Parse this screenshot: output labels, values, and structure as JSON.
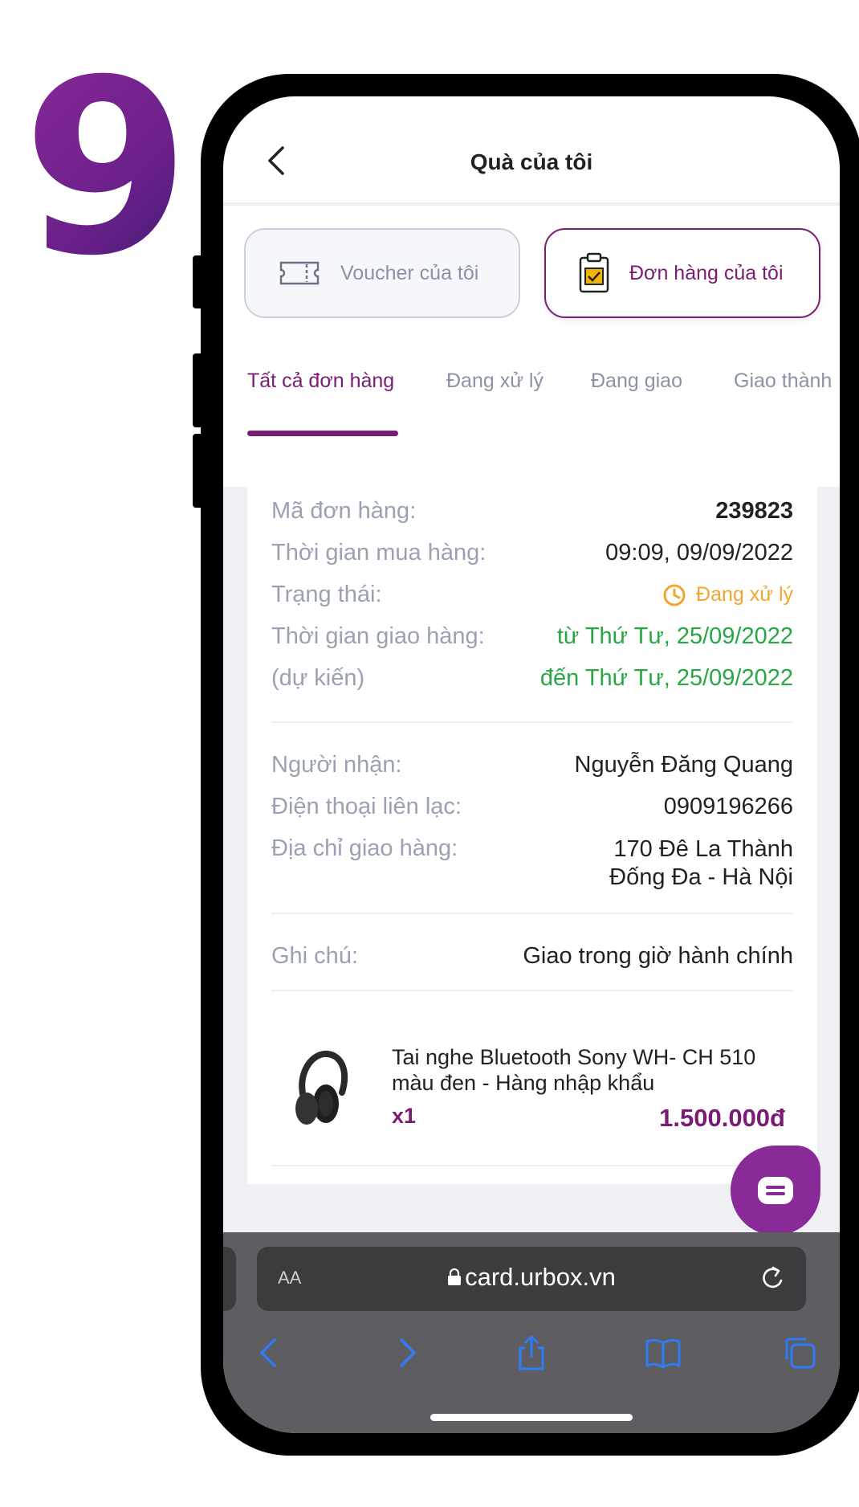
{
  "step_number": "9",
  "header": {
    "title": "Quà của tôi"
  },
  "segments": {
    "voucher": "Voucher của tôi",
    "orders": "Đơn hàng của tôi"
  },
  "tabs": [
    {
      "label": "Tất cả đơn hàng",
      "active": true
    },
    {
      "label": "Đang xử lý"
    },
    {
      "label": "Đang giao"
    },
    {
      "label": "Giao thành"
    }
  ],
  "order": {
    "id_label": "Mã đơn hàng:",
    "id_value": "239823",
    "purchase_time_label": "Thời gian mua hàng:",
    "purchase_time_value": "09:09, 09/09/2022",
    "status_label": "Trạng thái:",
    "status_value": "Đang xử lý",
    "delivery_time_label": "Thời gian giao hàng:",
    "delivery_time_label2": "(dự kiến)",
    "delivery_from": "từ Thứ Tư, 25/09/2022",
    "delivery_to": "đến Thứ Tư, 25/09/2022",
    "recipient_label": "Người nhận:",
    "recipient_value": "Nguyễn Đăng Quang",
    "phone_label": "Điện thoại liên lạc:",
    "phone_value": "0909196266",
    "address_label": "Địa chỉ giao hàng:",
    "address_line1": "170 Đê La Thành",
    "address_line2": "Đống Đa - Hà Nội",
    "note_label": "Ghi chú:",
    "note_value": "Giao trong giờ hành chính"
  },
  "product": {
    "name": "Tai nghe Bluetooth Sony WH- CH 510 màu đen - Hàng nhập khẩu",
    "qty": "x1",
    "price": "1.500.000đ"
  },
  "browser": {
    "aa": "AA",
    "url": "card.urbox.vn"
  },
  "colors": {
    "brand": "#7a1c72",
    "green": "#27a844",
    "orange": "#f2a52e",
    "ios_blue": "#2f7cf6"
  }
}
